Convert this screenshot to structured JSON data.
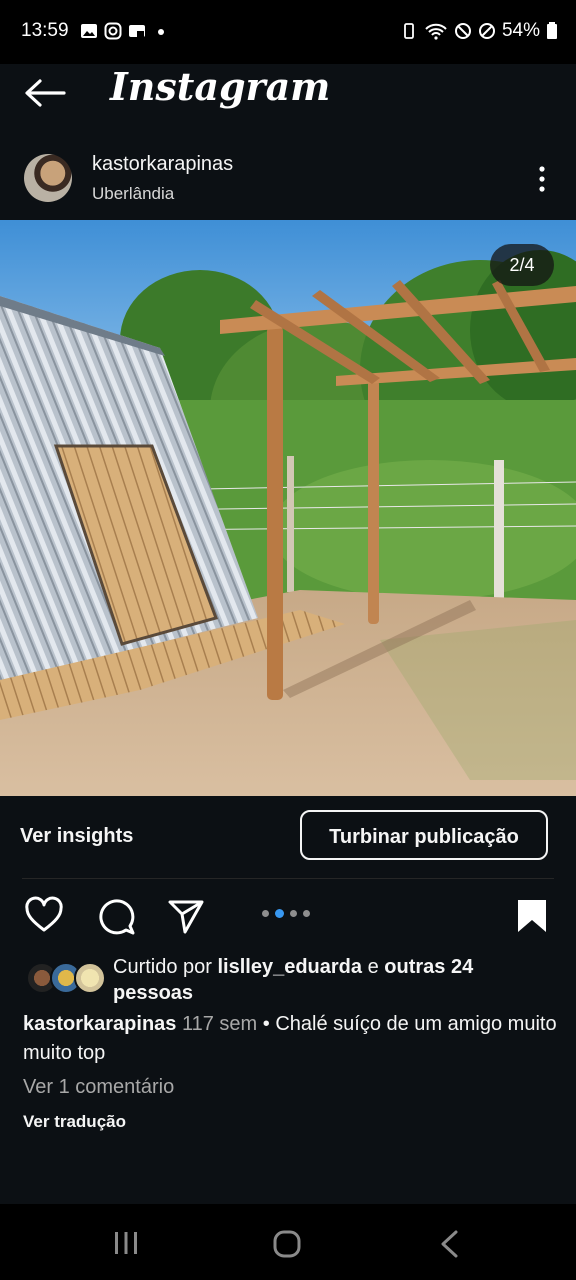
{
  "status_bar": {
    "time": "13:59",
    "battery": "54%",
    "icons_left": [
      "gallery-icon",
      "instagram-icon",
      "cast-icon",
      "dot-icon"
    ],
    "icons_right": [
      "battery-saver-icon",
      "wifi-icon",
      "do-not-disturb-icon",
      "blocked-icon"
    ]
  },
  "header": {
    "title": "Instagram"
  },
  "post": {
    "username": "kastorkarapinas",
    "location": "Uberlândia",
    "image_counter": "2/4",
    "insights_label": "Ver insights",
    "boost_label": "Turbinar publicação",
    "likes_prefix": "Curtido por ",
    "likes_user": "lislley_eduarda",
    "likes_suffix": " e ",
    "likes_others": "outras 24 pessoas",
    "caption_user": "kastorkarapinas",
    "caption_time": "117 sem",
    "caption_text": " • Chalé suíço de um amigo muito muito top",
    "view_comments": "Ver 1 comentário",
    "view_translation": "Ver tradução"
  },
  "colors": {
    "background": "#0c1014",
    "accent": "#3897f0",
    "muted": "#a8a8a8"
  }
}
